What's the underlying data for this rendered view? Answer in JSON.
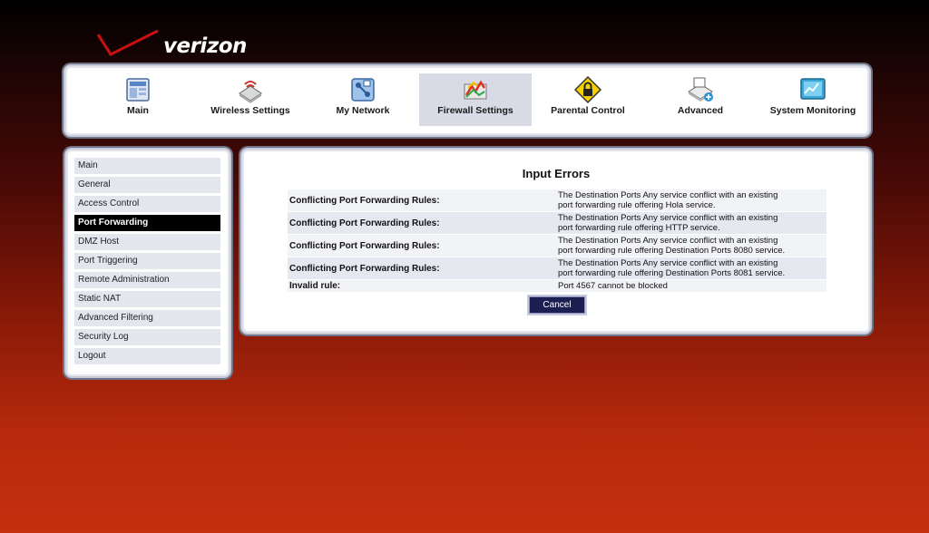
{
  "brand": {
    "name": "verizon",
    "accent": "#cc0000"
  },
  "topnav": {
    "items": [
      {
        "label": "Main",
        "icon": "main-icon",
        "active": false
      },
      {
        "label": "Wireless Settings",
        "icon": "wireless-icon",
        "active": false
      },
      {
        "label": "My Network",
        "icon": "network-icon",
        "active": false
      },
      {
        "label": "Firewall Settings",
        "icon": "firewall-icon",
        "active": true
      },
      {
        "label": "Parental Control",
        "icon": "parental-control-icon",
        "active": false
      },
      {
        "label": "Advanced",
        "icon": "advanced-icon",
        "active": false
      },
      {
        "label": "System Monitoring",
        "icon": "monitoring-icon",
        "active": false
      }
    ]
  },
  "sidenav": {
    "items": [
      {
        "label": "Main",
        "active": false
      },
      {
        "label": "General",
        "active": false
      },
      {
        "label": "Access Control",
        "active": false
      },
      {
        "label": "Port Forwarding",
        "active": true
      },
      {
        "label": "DMZ Host",
        "active": false
      },
      {
        "label": "Port Triggering",
        "active": false
      },
      {
        "label": "Remote Administration",
        "active": false
      },
      {
        "label": "Static NAT",
        "active": false
      },
      {
        "label": "Advanced Filtering",
        "active": false
      },
      {
        "label": "Security Log",
        "active": false
      },
      {
        "label": "Logout",
        "active": false
      }
    ]
  },
  "content": {
    "title": "Input Errors",
    "errors": [
      {
        "label": "Conflicting Port Forwarding Rules:",
        "line1": "The Destination Ports Any service conflict with an existing",
        "line2": "port forwarding rule offering Hola service."
      },
      {
        "label": "Conflicting Port Forwarding Rules:",
        "line1": "The Destination Ports Any service conflict with an existing",
        "line2": "port forwarding rule offering HTTP service."
      },
      {
        "label": "Conflicting Port Forwarding Rules:",
        "line1": "The Destination Ports Any service conflict with an existing",
        "line2": "port forwarding rule offering Destination Ports 8080 service."
      },
      {
        "label": "Conflicting Port Forwarding Rules:",
        "line1": "The Destination Ports Any service conflict with an existing",
        "line2": "port forwarding rule offering Destination Ports 8081 service."
      },
      {
        "label": "Invalid rule:",
        "line1": "Port 4567 cannot be blocked",
        "line2": ""
      }
    ],
    "cancel_label": "Cancel"
  }
}
